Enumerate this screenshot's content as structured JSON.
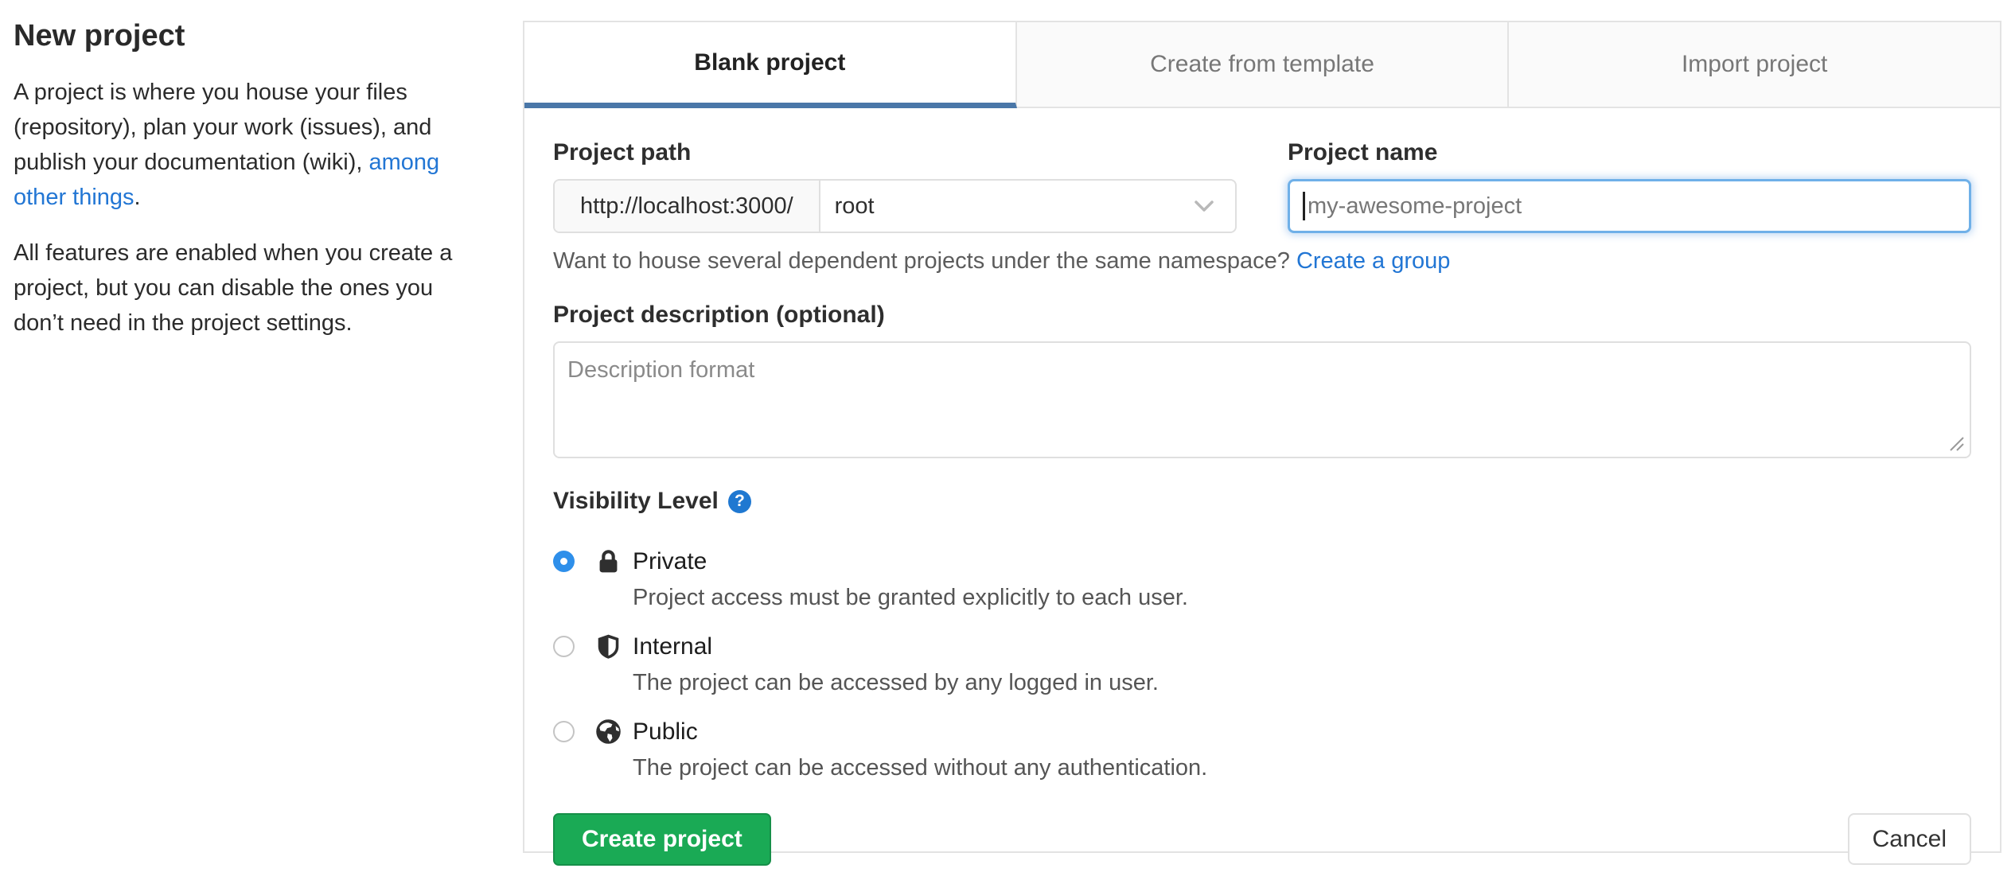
{
  "sidebar": {
    "heading": "New project",
    "paragraph1": {
      "pre": "A project is where you house your files\n(repository), plan your work (issues), and\npublish your documentation (wiki), ",
      "link": "among\nother things",
      "post": "."
    },
    "paragraph2": "All features are enabled when you create a\nproject, but you can disable the ones you\ndon’t need in the project settings."
  },
  "tabs": [
    {
      "label": "Blank project",
      "active": true
    },
    {
      "label": "Create from template",
      "active": false
    },
    {
      "label": "Import project",
      "active": false
    }
  ],
  "form": {
    "project_path": {
      "label": "Project path",
      "url_prefix": "http://localhost:3000/",
      "namespace_selected": "root"
    },
    "project_name": {
      "label": "Project name",
      "value": "",
      "placeholder": "my-awesome-project"
    },
    "namespace_hint": {
      "text": "Want to house several dependent projects under the same namespace? ",
      "link": "Create a group"
    },
    "description": {
      "label": "Project description (optional)",
      "value": "",
      "placeholder": "Description format"
    },
    "visibility": {
      "label": "Visibility Level",
      "help_glyph": "?",
      "options": [
        {
          "label": "Private",
          "desc": "Project access must be granted explicitly to each user.",
          "selected": true
        },
        {
          "label": "Internal",
          "desc": "The project can be accessed by any logged in user.",
          "selected": false
        },
        {
          "label": "Public",
          "desc": "The project can be accessed without any authentication.",
          "selected": false
        }
      ]
    },
    "actions": {
      "submit": "Create project",
      "cancel": "Cancel"
    }
  },
  "colors": {
    "accent_green": "#1aaa55",
    "accent_green_border": "#168f48",
    "link_blue": "#2276d4",
    "tab_underline_blue": "#4a77a8",
    "radio_blue": "#2e8fea",
    "help_icon_blue": "#1f78d1",
    "focus_border_blue": "#6fb0e8"
  }
}
